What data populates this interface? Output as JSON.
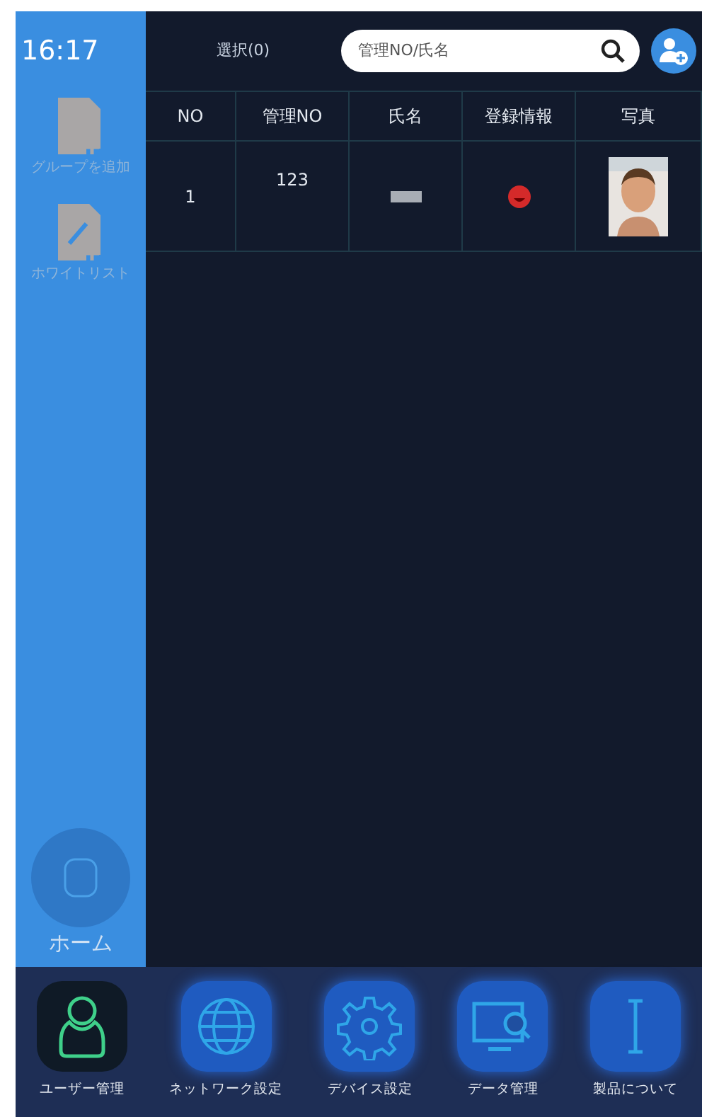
{
  "clock": "16:17",
  "header": {
    "selection": "選択(0)",
    "search": {
      "placeholder": "管理NO/氏名"
    }
  },
  "sidebar": {
    "items": [
      {
        "label": "グループを追加",
        "kind": "group"
      },
      {
        "label": "ホワイトリスト",
        "kind": "whitelist"
      }
    ],
    "home": {
      "label": "ホーム"
    }
  },
  "table": {
    "columns": [
      "NO",
      "管理NO",
      "氏名",
      "登録情報",
      "写真"
    ],
    "rows": [
      {
        "no": "1",
        "id": "123",
        "name_hidden": true,
        "registered": true
      }
    ]
  },
  "bottom_nav": [
    {
      "label": "ユーザー管理",
      "kind": "user",
      "selected": true
    },
    {
      "label": "ネットワーク設定",
      "kind": "globe",
      "selected": false
    },
    {
      "label": "デバイス設定",
      "kind": "gear",
      "selected": false
    },
    {
      "label": "データ管理",
      "kind": "monitor",
      "selected": false
    },
    {
      "label": "製品について",
      "kind": "info",
      "selected": false
    }
  ]
}
